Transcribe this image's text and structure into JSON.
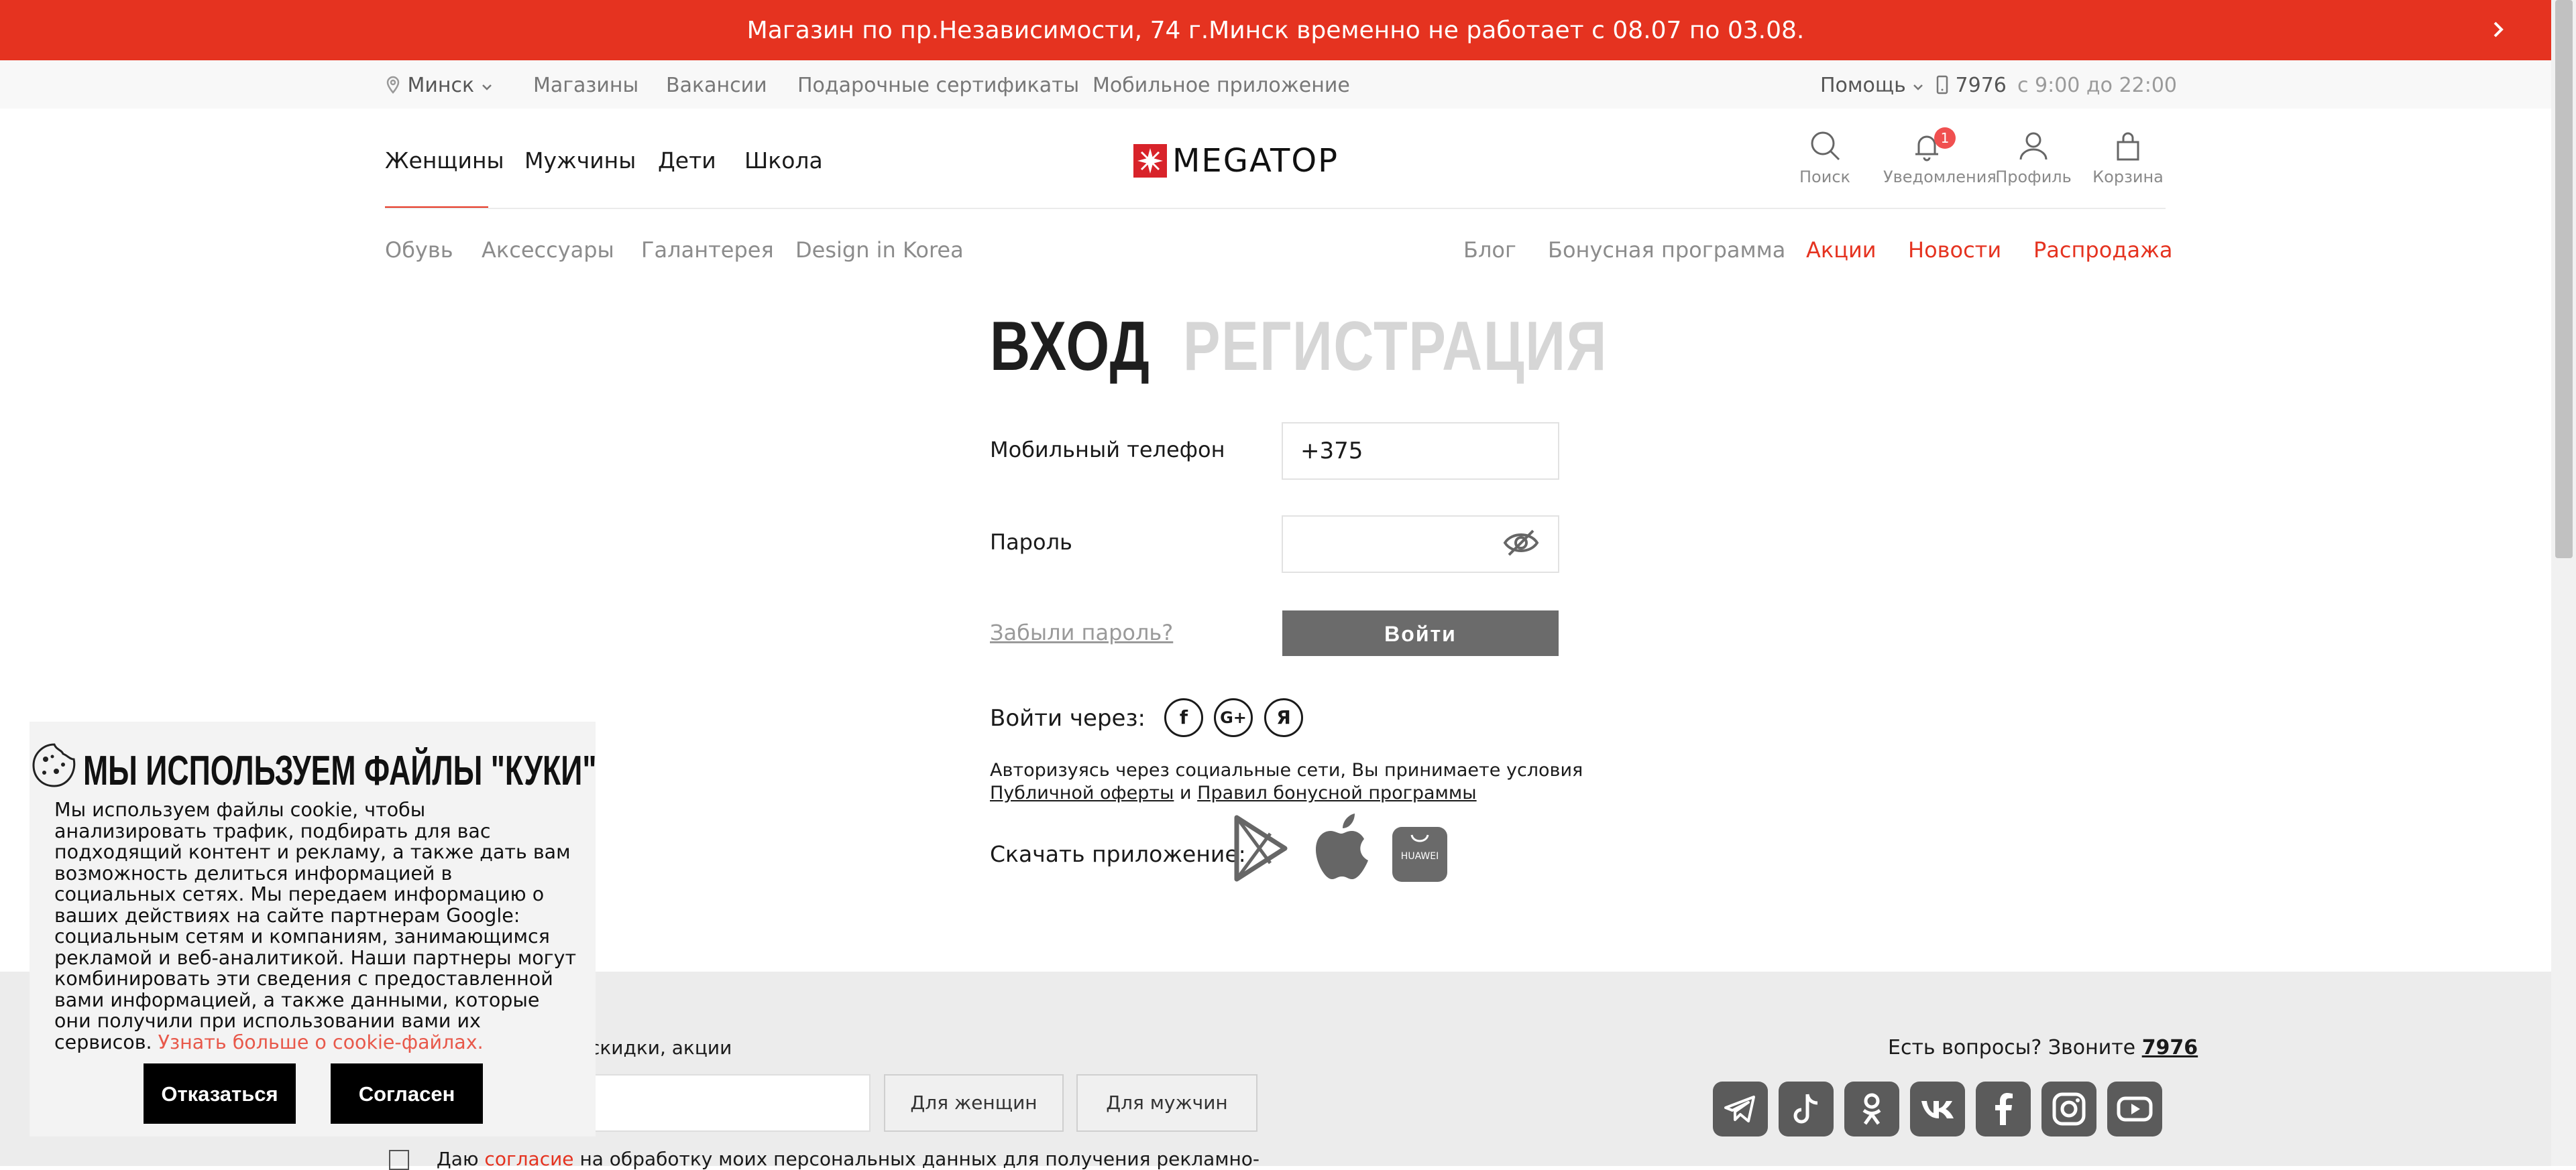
{
  "banner": {
    "text": "Магазин по пр.Независимости, 74 г.Минск временно не работает с 08.07 по 03.08."
  },
  "utilbar": {
    "city": "Минск",
    "links": [
      "Магазины",
      "Вакансии",
      "Подарочные сертификаты",
      "Мобильное приложение"
    ],
    "help": "Помощь",
    "phone": "7976",
    "hours": "с 9:00 до 22:00"
  },
  "header": {
    "categories": [
      "Женщины",
      "Мужчины",
      "Дети",
      "Школа"
    ],
    "logo_text": "MEGATOP",
    "icons": {
      "search": "Поиск",
      "notifications": "Уведомления",
      "notifications_count": "1",
      "profile": "Профиль",
      "cart": "Корзина"
    }
  },
  "subnav": {
    "left": [
      "Обувь",
      "Аксессуары",
      "Галантерея",
      "Design in Korea"
    ],
    "right": [
      "Блог",
      "Бонусная программа",
      "Акции",
      "Новости",
      "Распродажа"
    ]
  },
  "login": {
    "tab_login": "ВХОД",
    "tab_register": "РЕГИСТРАЦИЯ",
    "phone_label": "Мобильный телефон",
    "phone_value": "+375",
    "password_label": "Пароль",
    "password_value": "",
    "forgot": "Забыли пароль?",
    "submit": "Войти",
    "via_label": "Войти через:",
    "social": [
      "f",
      "G+",
      "Я"
    ],
    "terms_1": "Авторизуясь через социальные сети, Вы принимаете условия",
    "terms_offer": "Публичной оферты",
    "terms_and": "и",
    "terms_bonus": "Правил бонусной программы",
    "download_label": "Скачать приложение:",
    "huawei": "HUAWEI"
  },
  "footer": {
    "subscribe_text": "и, скидки, акции",
    "btn_women": "Для женщин",
    "btn_men": "Для мужчин",
    "question": "Есть вопросы? Звоните",
    "question_phone": "7976",
    "consent_1": "Даю",
    "consent_link": "согласие",
    "consent_2": "на обработку моих персональных данных для получения рекламно-"
  },
  "cookie": {
    "title": "МЫ ИСПОЛЬЗУЕМ ФАЙЛЫ \"КУКИ\"",
    "text": "Мы используем файлы cookie, чтобы анализировать трафик, подбирать для вас подходящий контент и рекламу, а также дать вам возможность делиться информацией в социальных сетях. Мы передаем информацию о ваших действиях на сайте партнерам Google: социальным сетям и компаниям, занимающимся рекламой и веб-аналитикой. Наши партнеры могут комбинировать эти сведения с предоставленной вами информацией, а также данными, которые они получили при использовании вами их сервисов.",
    "link": "Узнать больше о cookie-файлах.",
    "decline": "Отказаться",
    "accept": "Согласен"
  },
  "colors": {
    "accent": "#e53320",
    "button_gray": "#6b6b6b",
    "footer_icon": "#5b5b5b"
  }
}
